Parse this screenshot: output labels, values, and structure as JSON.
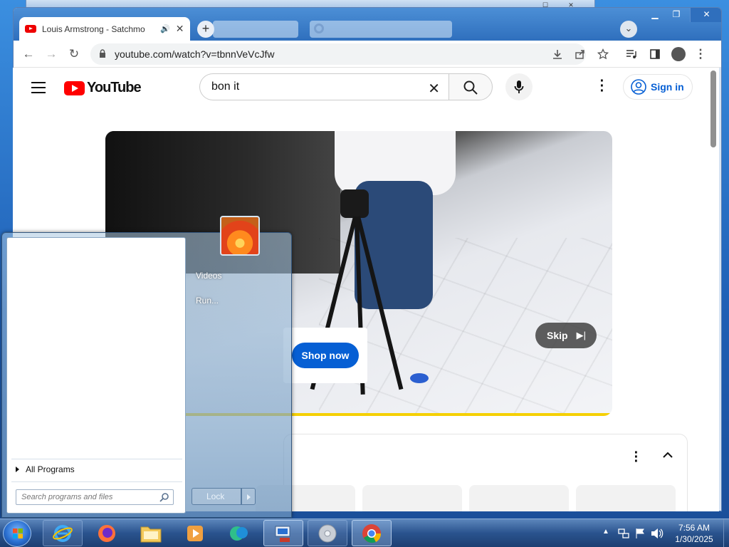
{
  "browser": {
    "tab": {
      "title": "Louis Armstrong - Satchmo",
      "favicon": "youtube-icon",
      "audio_icon": "speaker-icon"
    },
    "url": "youtube.com/watch?v=tbnnVeVcJfw",
    "controls": [
      "back-icon",
      "forward-icon",
      "reload-icon",
      "download-icon",
      "share-icon",
      "star-icon",
      "media-icon",
      "sidebar-icon",
      "profile-icon",
      "menu-icon"
    ]
  },
  "youtube": {
    "logo_text": "YouTube",
    "search_value": "bon it",
    "sign_in_label": "Sign in",
    "ad": {
      "skip_label": "Skip",
      "shop_now_label": "Shop now"
    }
  },
  "start_menu": {
    "right_items": [
      "Videos",
      "Run..."
    ],
    "all_programs_label": "All Programs",
    "search_placeholder": "Search programs and files",
    "lock_label": "Lock"
  },
  "taskbar": {
    "pinned": [
      "internet-explorer-icon",
      "firefox-icon",
      "explorer-folder-icon",
      "media-player-icon",
      "live-messenger-icon",
      "remote-desktop-icon",
      "disc-icon",
      "chrome-icon"
    ],
    "clock_time": "7:56 AM",
    "clock_date": "1/30/2025"
  },
  "colors": {
    "youtube_red": "#ff0000",
    "link_blue": "#065fd4",
    "ad_progress": "#f5d000"
  }
}
